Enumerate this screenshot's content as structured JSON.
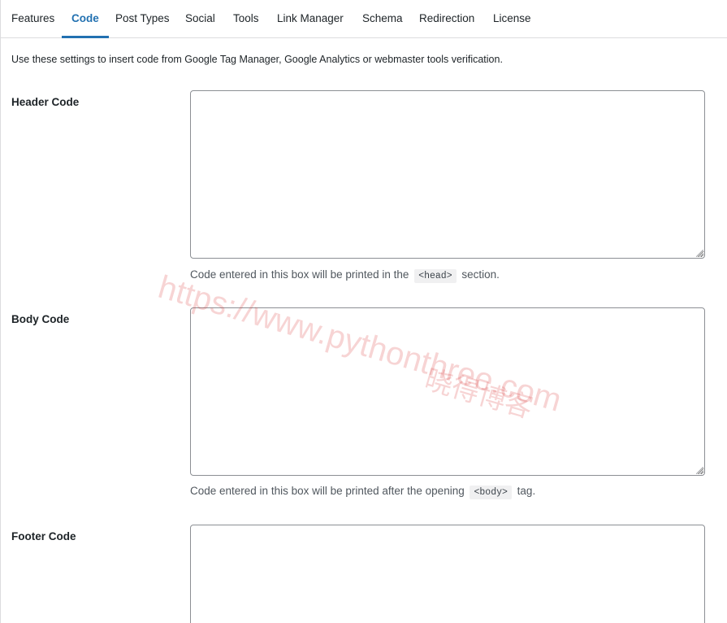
{
  "tabs": [
    {
      "label": "Features",
      "active": false
    },
    {
      "label": "Code",
      "active": true
    },
    {
      "label": "Post Types",
      "active": false
    },
    {
      "label": "Social",
      "active": false
    },
    {
      "label": "Tools",
      "active": false
    },
    {
      "label": "Link Manager",
      "active": false
    },
    {
      "label": "Schema",
      "active": false
    },
    {
      "label": "Redirection",
      "active": false
    },
    {
      "label": "License",
      "active": false
    }
  ],
  "intro": "Use these settings to insert code from Google Tag Manager, Google Analytics or webmaster tools verification.",
  "header": {
    "label": "Header Code",
    "value": "",
    "desc_before": "Code entered in this box will be printed in the",
    "desc_code": "<head>",
    "desc_after": "section."
  },
  "body": {
    "label": "Body Code",
    "value": "",
    "desc_before": "Code entered in this box will be printed after the opening",
    "desc_code": "<body>",
    "desc_after": "tag."
  },
  "footer": {
    "label": "Footer Code",
    "value": ""
  },
  "watermark": {
    "url": "https://www.pythonthree.com",
    "name": "晓得博客"
  },
  "colors": {
    "accent": "#2271b1",
    "text": "#1d2327",
    "muted": "#50575e",
    "border": "#8c8f94"
  }
}
